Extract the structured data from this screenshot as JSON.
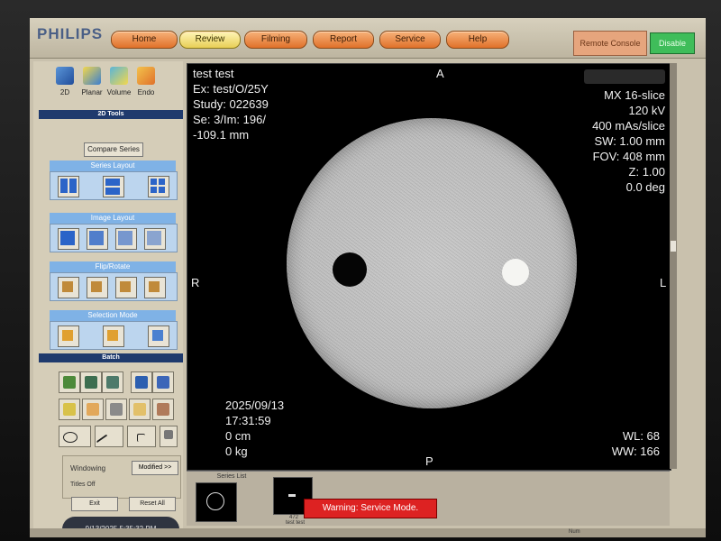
{
  "brand": "PHILIPS",
  "nav": {
    "home": "Home",
    "review": "Review",
    "filming": "Filming",
    "report": "Report",
    "service": "Service",
    "help": "Help"
  },
  "remote_console": "Remote Console",
  "disable": "Disable",
  "tool_tabs": [
    "2D",
    "Planar",
    "Volume",
    "Endo"
  ],
  "sections": {
    "tools2d": "2D Tools",
    "compare": "Compare Series",
    "series_layout": "Series Layout",
    "image_layout": "Image Layout",
    "flip_rotate": "Flip/Rotate",
    "selection_mode": "Selection Mode",
    "batch": "Batch"
  },
  "windowing": {
    "label": "Windowing",
    "modified": "Modified >>",
    "titles_off": "Titles Off"
  },
  "exit": "Exit",
  "reset_all": "Reset All",
  "datetime_pill": "9/13/2025 5:35:32 PM",
  "overlay": {
    "top_left": [
      "test test",
      "Ex: test/O/25Y",
      "Study: 022639",
      "Se: 3/Im: 196/",
      "-109.1 mm"
    ],
    "top_right": [
      "MX 16-slice",
      "120 kV",
      "400 mAs/slice",
      "SW: 1.00 mm",
      "FOV: 408 mm",
      "Z: 1.00",
      "0.0 deg"
    ],
    "bottom_left": [
      "2025/09/13",
      "17:31:59",
      "0 cm",
      "0 kg"
    ],
    "bottom_right": [
      "WL: 68",
      "WW: 166"
    ],
    "orient": {
      "top": "A",
      "bottom": "P",
      "left": "R",
      "right": "L"
    }
  },
  "series_list": "Series List",
  "thumb_caption": "test test",
  "thumb_num": "472",
  "warning": "Warning: Service Mode.",
  "status_num": "Num",
  "colors": {
    "accent": "#e0712a",
    "active": "#e8cf56",
    "panel_header": "#1f3a6d",
    "group_header": "#7fb2e6",
    "warning": "#dd2222"
  }
}
